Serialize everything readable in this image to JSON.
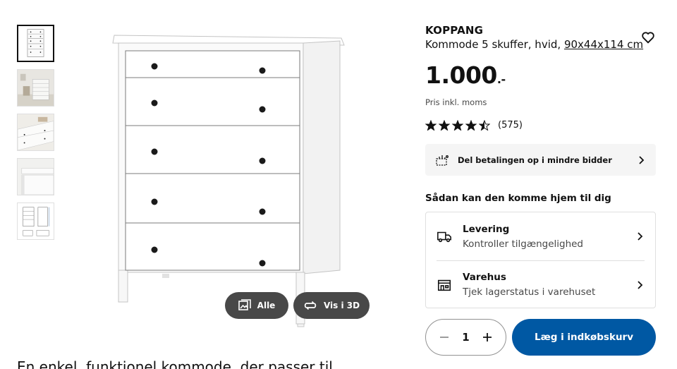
{
  "gallery": {
    "thumbnails": [
      {
        "name": "front-view"
      },
      {
        "name": "room-view"
      },
      {
        "name": "top-detail"
      },
      {
        "name": "drawer-detail"
      },
      {
        "name": "dimensions"
      }
    ],
    "all_label": "Alle",
    "view3d_label": "Vis i 3D"
  },
  "product": {
    "name": "KOPPANG",
    "subtitle": "Kommode 5 skuffer, hvid,",
    "dimensions": "90x44x114 cm",
    "price_main": "1.000",
    "price_suffix": ".-",
    "price_note": "Pris inkl. moms",
    "rating_value": 4.5,
    "review_count": "(575)",
    "description_start": "En enkel, funktionel kommode, der passer til"
  },
  "payment": {
    "label": "Del betalingen op i mindre bidder"
  },
  "delivery": {
    "heading": "Sådan kan den komme hjem til dig",
    "options": [
      {
        "title": "Levering",
        "subtitle": "Kontroller tilgængelighed",
        "icon": "truck-icon"
      },
      {
        "title": "Varehus",
        "subtitle": "Tjek lagerstatus i varehuset",
        "icon": "store-icon"
      }
    ]
  },
  "cart": {
    "quantity": "1",
    "add_label": "Læg i indkøbskurv"
  },
  "colors": {
    "accent": "#0058a3",
    "dark_button": "#484848"
  }
}
